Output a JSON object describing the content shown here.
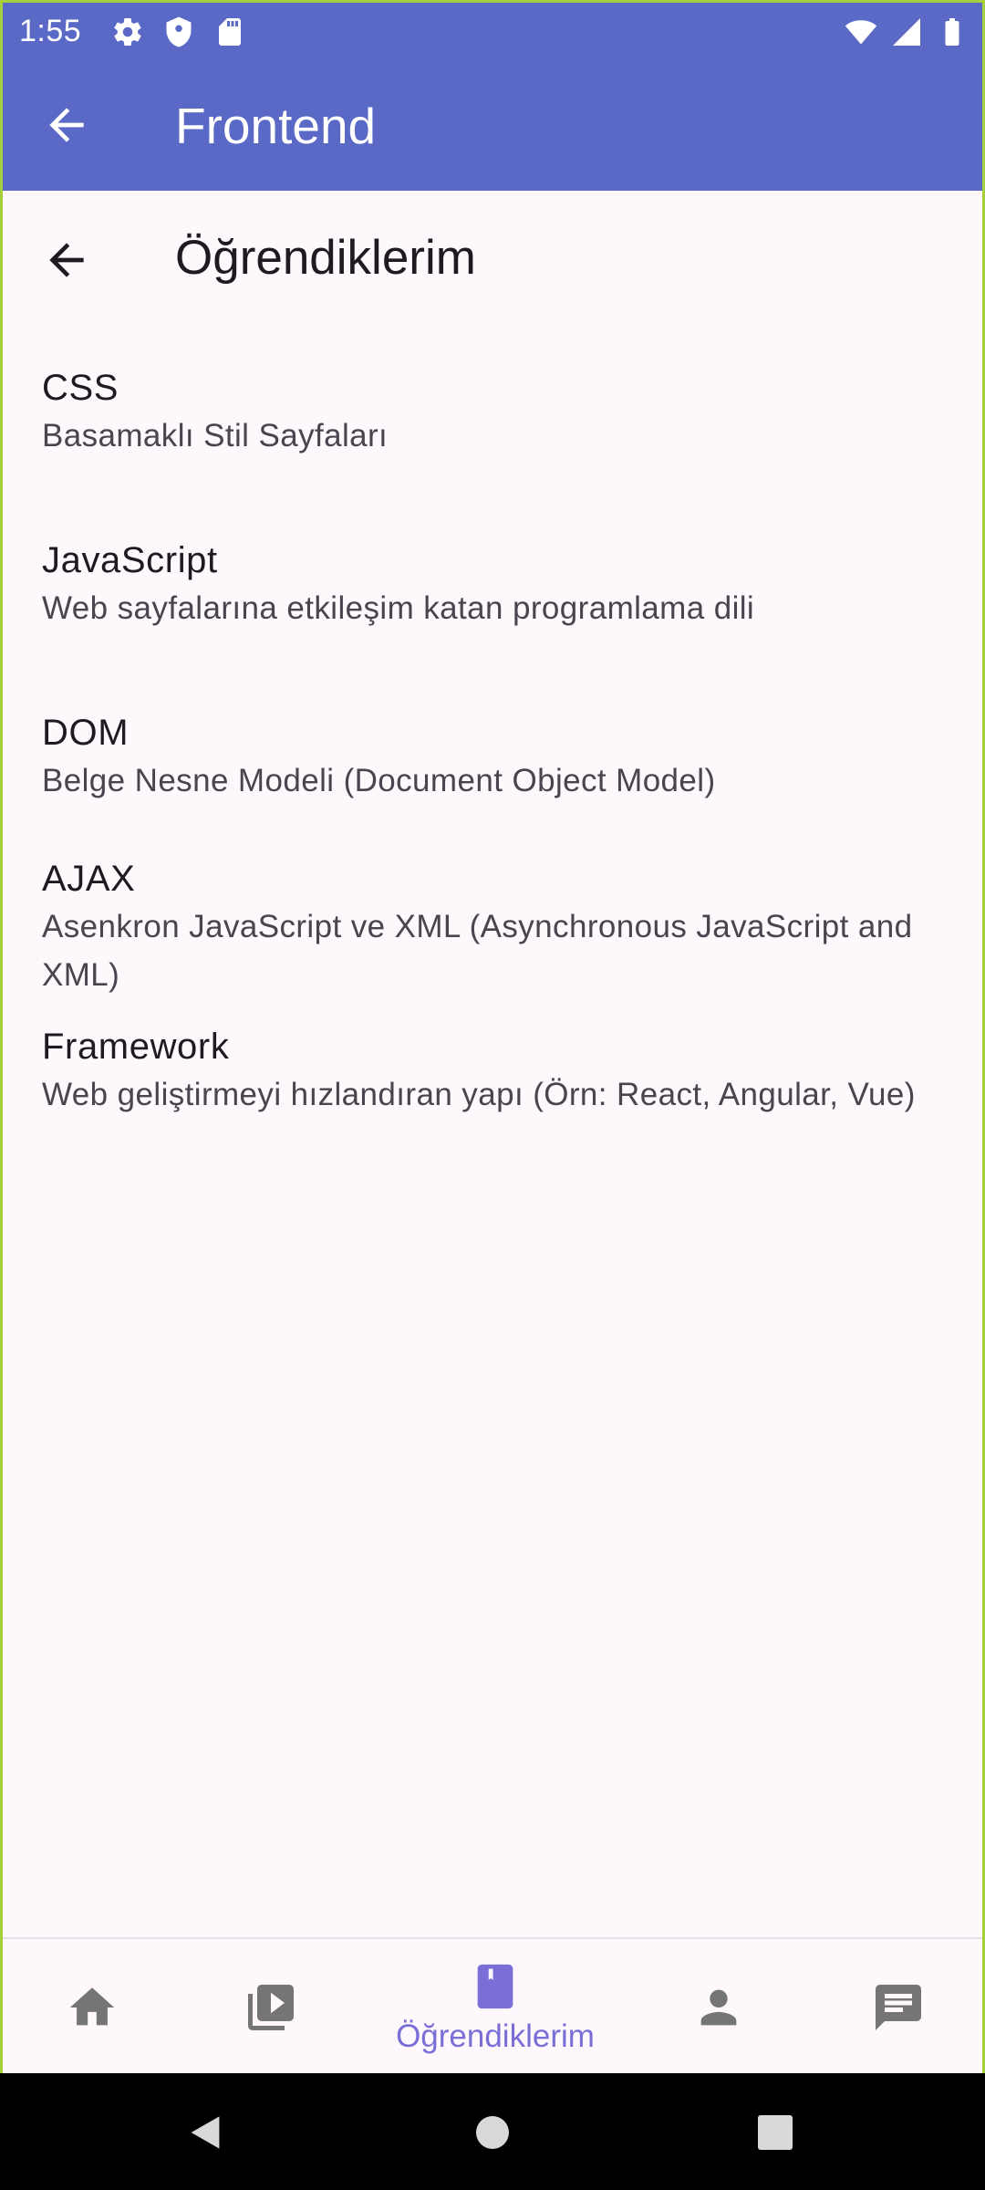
{
  "status_bar": {
    "time": "1:55",
    "left_icons": [
      "settings-icon",
      "shield-icon",
      "sd-card-icon"
    ],
    "right_icons": [
      "wifi-icon",
      "signal-icon",
      "battery-icon"
    ]
  },
  "app_bar": {
    "title": "Frontend",
    "back_icon": "arrow-back-icon",
    "background": "#5a68c6"
  },
  "page": {
    "title": "Öğrendiklerim",
    "back_icon": "arrow-back-icon"
  },
  "items": [
    {
      "title": "CSS",
      "subtitle": "Basamaklı Stil Sayfaları"
    },
    {
      "title": "JavaScript",
      "subtitle": "Web sayfalarına etkileşim katan programlama dili"
    },
    {
      "title": "DOM",
      "subtitle": "Belge Nesne Modeli (Document Object Model)"
    },
    {
      "title": "AJAX",
      "subtitle": "Asenkron JavaScript ve XML (Asynchronous JavaScript and XML)"
    },
    {
      "title": "Framework",
      "subtitle": "Web geliştirmeyi hızlandıran yapı (Örn: React, Angular, Vue)"
    }
  ],
  "bottom_nav": {
    "active_index": 2,
    "active_color": "#7a6fd6",
    "inactive_color": "#757575",
    "items": [
      {
        "icon": "home-icon"
      },
      {
        "icon": "video-library-icon"
      },
      {
        "icon": "bookmark-icon",
        "label": "Öğrendiklerim"
      },
      {
        "icon": "person-icon"
      },
      {
        "icon": "chat-icon"
      }
    ]
  },
  "system_nav": [
    "back-triangle-icon",
    "home-circle-icon",
    "recents-square-icon"
  ]
}
